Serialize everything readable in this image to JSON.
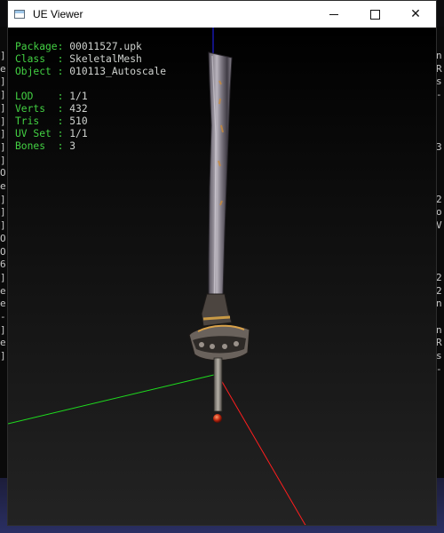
{
  "window": {
    "title": "UE Viewer"
  },
  "controls": {
    "minimize": "minimize",
    "maximize": "maximize",
    "close": "✕"
  },
  "info_rows": [
    {
      "label": "Package:",
      "value": " 00011527.upk"
    },
    {
      "label": "Class  :",
      "value": " SkeletalMesh"
    },
    {
      "label": "Object :",
      "value": " 010113_Autoscale"
    }
  ],
  "stats_rows": [
    {
      "label": "LOD    :",
      "value": " 1/1"
    },
    {
      "label": "Verts  :",
      "value": " 432"
    },
    {
      "label": "Tris   :",
      "value": " 510"
    },
    {
      "label": "UV Set :",
      "value": " 1/1"
    },
    {
      "label": "Bones  :",
      "value": " 3"
    }
  ],
  "background_console": {
    "left_chars": [
      "]",
      "e",
      "]",
      "]",
      "]",
      "]",
      "]",
      "]",
      "]",
      "O",
      "e",
      "]",
      "]",
      "]",
      "O",
      "O",
      "6",
      "]",
      "e",
      "e",
      "-",
      "]",
      "e",
      "]"
    ],
    "right_chars": [
      "n",
      "R",
      "s",
      "-",
      "",
      "",
      "",
      "3",
      "",
      "",
      "",
      "2",
      "o",
      "V",
      "",
      "",
      "",
      "2",
      "2",
      "n",
      "",
      "n",
      "R",
      "s",
      "-"
    ]
  },
  "colors": {
    "axis_x": "#ff1e1e",
    "axis_y": "#1edc1e",
    "axis_z": "#2222ff",
    "label_green": "#43d143"
  },
  "icons": {
    "app": "window-app-icon",
    "sword": "sword-mesh"
  }
}
